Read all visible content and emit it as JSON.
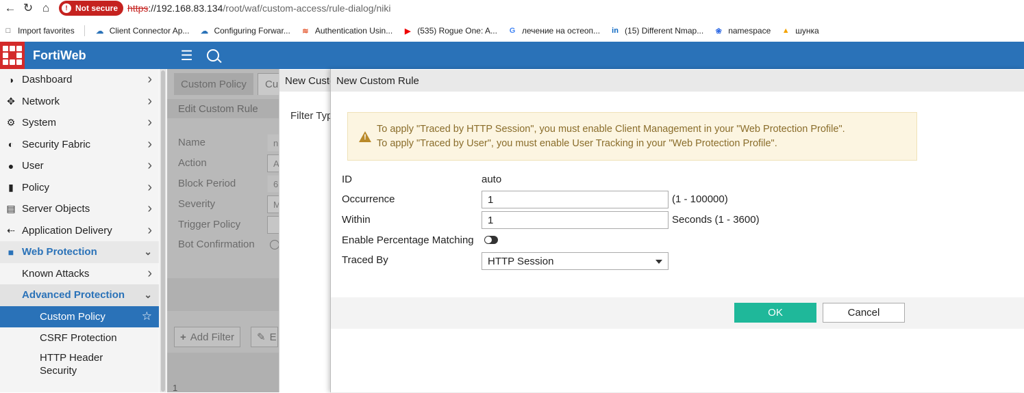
{
  "browser": {
    "security_label": "Not secure",
    "url_scheme": "https",
    "url_rest": "://192.168.83.134",
    "url_path": "/root/waf/custom-access/rule-dialog/niki"
  },
  "bookmarks": [
    {
      "label": "Import favorites",
      "icon": "import-icon",
      "color": "#444"
    },
    {
      "label": "Client Connector Ap...",
      "icon": "cloud-icon",
      "color": "#2a72b8"
    },
    {
      "label": "Configuring Forwar...",
      "icon": "cloud-icon",
      "color": "#2a72b8"
    },
    {
      "label": "Authentication Usin...",
      "icon": "paloalto-icon",
      "color": "#e4572e"
    },
    {
      "label": "(535) Rogue One: A...",
      "icon": "youtube-icon",
      "color": "#e00"
    },
    {
      "label": "лечение на остеоп...",
      "icon": "google-icon",
      "color": "#4285f4"
    },
    {
      "label": "(15) Different Nmap...",
      "icon": "linkedin-icon",
      "color": "#0a66c2"
    },
    {
      "label": "namespace",
      "icon": "kubernetes-icon",
      "color": "#326ce5"
    },
    {
      "label": "шунка",
      "icon": "logo-icon",
      "color": "#f4a300"
    }
  ],
  "app": {
    "title": "FortiWeb"
  },
  "sidebar": {
    "items": [
      {
        "label": "Dashboard",
        "icon": "dashboard-icon"
      },
      {
        "label": "Network",
        "icon": "network-icon"
      },
      {
        "label": "System",
        "icon": "gear-icon"
      },
      {
        "label": "Security Fabric",
        "icon": "fabric-icon"
      },
      {
        "label": "User",
        "icon": "user-icon"
      },
      {
        "label": "Policy",
        "icon": "policy-icon"
      },
      {
        "label": "Server Objects",
        "icon": "server-icon"
      },
      {
        "label": "Application Delivery",
        "icon": "delivery-icon"
      },
      {
        "label": "Web Protection",
        "icon": "lock-icon"
      }
    ],
    "sub_items": [
      {
        "label": "Known Attacks"
      },
      {
        "label": "Advanced Protection"
      }
    ],
    "sub2_items": [
      {
        "label": "Custom Policy"
      },
      {
        "label": "CSRF Protection"
      },
      {
        "label": "HTTP Header Security"
      }
    ]
  },
  "background_page": {
    "tabs": [
      "Custom Policy",
      "Cu"
    ],
    "subheader": "Edit Custom Rule",
    "fields": [
      "Name",
      "Action",
      "Block Period",
      "Severity",
      "Trigger Policy",
      "Bot Confirmation"
    ],
    "field_values": [
      "n",
      "A",
      "6",
      "M",
      ""
    ],
    "add_filter": "Add Filter",
    "edit_partial": "E",
    "page_num": "1"
  },
  "dialog_behind": {
    "title": "New Custom",
    "filter_label": "Filter Typ"
  },
  "dialog": {
    "title": "New Custom Rule",
    "warning_lines": [
      "To apply \"Traced by HTTP Session\", you must enable Client Management in your \"Web Protection Profile\".",
      "To apply \"Traced by User\", you must enable User Tracking in your \"Web Protection Profile\"."
    ],
    "id_label": "ID",
    "id_value": "auto",
    "occurrence_label": "Occurrence",
    "occurrence_value": "1",
    "occurrence_hint": "(1 - 100000)",
    "within_label": "Within",
    "within_value": "1",
    "within_hint": "Seconds (1 - 3600)",
    "percentage_label": "Enable Percentage Matching",
    "percentage_enabled": false,
    "traced_by_label": "Traced By",
    "traced_by_value": "HTTP Session",
    "ok_label": "OK",
    "cancel_label": "Cancel"
  },
  "colors": {
    "header": "#2a72b8",
    "ok_button": "#1fb89a",
    "warning_bg": "#fcf5e1",
    "warning_text": "#8a6d2b",
    "not_secure": "#c5221f"
  }
}
